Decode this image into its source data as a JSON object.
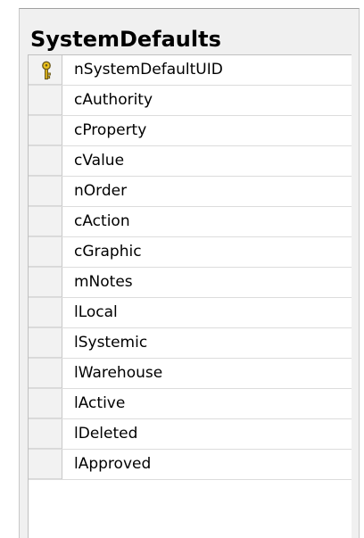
{
  "table": {
    "title": "SystemDefaults",
    "columns": [
      {
        "name": "nSystemDefaultUID",
        "primary_key": true,
        "icon": "key-icon"
      },
      {
        "name": "cAuthority",
        "primary_key": false
      },
      {
        "name": "cProperty",
        "primary_key": false
      },
      {
        "name": "cValue",
        "primary_key": false
      },
      {
        "name": "nOrder",
        "primary_key": false
      },
      {
        "name": "cAction",
        "primary_key": false
      },
      {
        "name": "cGraphic",
        "primary_key": false
      },
      {
        "name": "mNotes",
        "primary_key": false
      },
      {
        "name": "lLocal",
        "primary_key": false
      },
      {
        "name": "lSystemic",
        "primary_key": false
      },
      {
        "name": "lWarehouse",
        "primary_key": false
      },
      {
        "name": "lActive",
        "primary_key": false
      },
      {
        "name": "lDeleted",
        "primary_key": false
      },
      {
        "name": "lApproved",
        "primary_key": false
      }
    ]
  },
  "colors": {
    "key_icon_fill": "#f0c419",
    "key_icon_stroke": "#6b5a1e"
  }
}
